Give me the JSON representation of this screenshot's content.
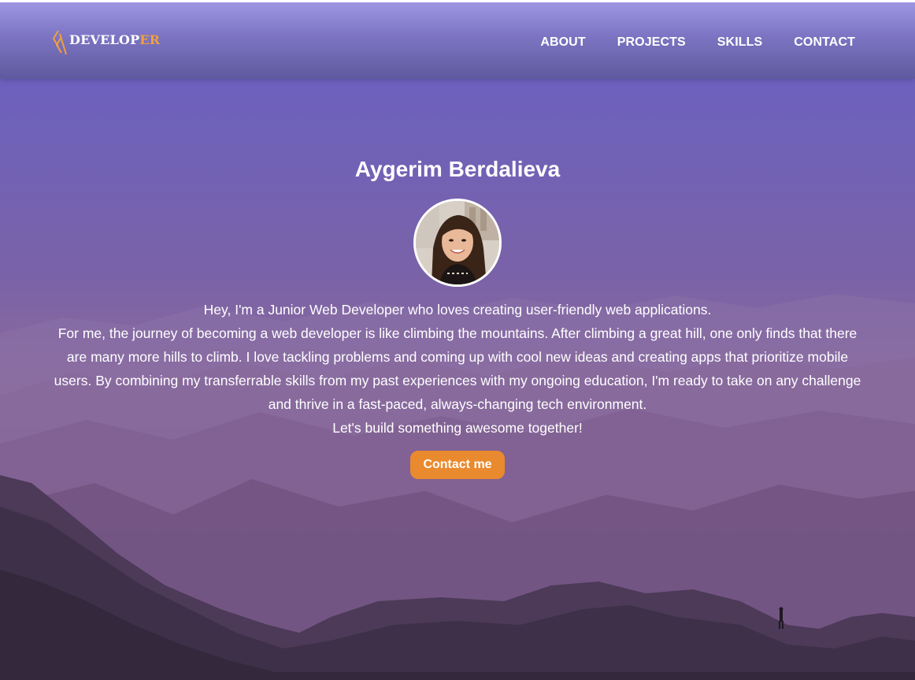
{
  "brand": {
    "logo_text_main": "DEVELOP",
    "logo_text_accent": "ER",
    "logo_icon": "code-slash-icon",
    "accent_color": "#f0a13c"
  },
  "nav": {
    "items": [
      {
        "label": "ABOUT"
      },
      {
        "label": "PROJECTS"
      },
      {
        "label": "SKILLS"
      },
      {
        "label": "CONTACT"
      }
    ]
  },
  "hero": {
    "name": "Aygerim Berdalieva",
    "avatar": "profile-photo",
    "bio": [
      "Hey, I'm a Junior Web Developer who loves creating user-friendly web applications.",
      "For me, the journey of becoming a web developer is like climbing the mountains. After climbing a great hill, one only finds that there are many more hills to climb. I love tackling problems and coming up with cool new ideas and creating apps that prioritize mobile users. By combining my transferrable skills from my past experiences with my ongoing education, I'm ready to take on any challenge and thrive in a fast-paced, always-changing tech environment.",
      "Let's build something awesome together!"
    ],
    "cta_label": "Contact me",
    "cta_color": "#ea8a2e",
    "background": "mountain-landscape-purple"
  }
}
